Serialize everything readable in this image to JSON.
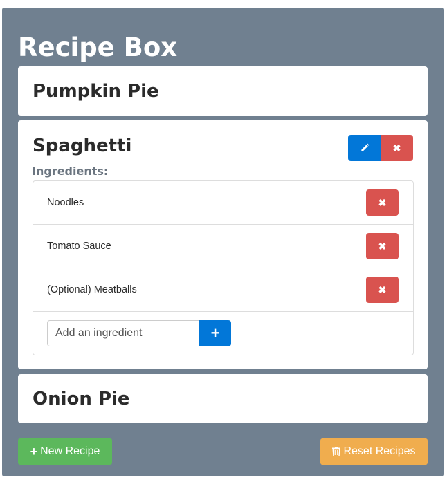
{
  "app": {
    "title": "Recipe Box"
  },
  "recipes": [
    {
      "name": "Pumpkin Pie"
    },
    {
      "name": "Spaghetti",
      "ingredients_label": "Ingredients:",
      "ingredients": [
        "Noodles",
        "Tomato Sauce",
        "(Optional) Meatballs"
      ],
      "add_placeholder": "Add an ingredient"
    },
    {
      "name": "Onion Pie"
    }
  ],
  "footer": {
    "new_recipe_label": "New Recipe",
    "reset_label": "Reset Recipes"
  },
  "icons": {
    "edit": "pencil-icon",
    "delete": "times-icon",
    "add": "plus-icon",
    "new": "plus-icon",
    "reset": "trash-icon"
  },
  "colors": {
    "background": "#708090",
    "primary": "#0277d8",
    "danger": "#d9534f",
    "success": "#5cb85c",
    "warning": "#f0ad4e"
  }
}
